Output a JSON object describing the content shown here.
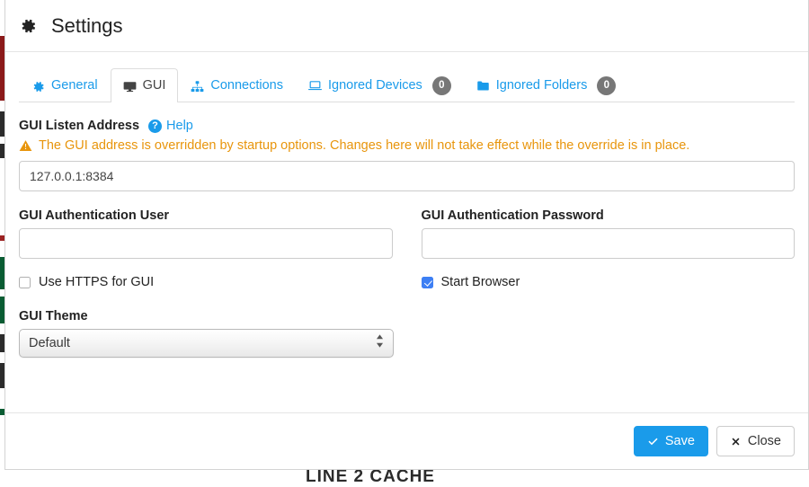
{
  "window": {
    "title": "Settings",
    "title_icon": "gear-icon"
  },
  "colors": {
    "link_blue": "#1a9bea",
    "warning_orange": "#e8950c",
    "badge_gray": "#777777",
    "checkbox_blue": "#3d7ff4",
    "primary_button": "#1a9bea"
  },
  "tabs": [
    {
      "label": "General",
      "icon": "gear-icon",
      "active": false,
      "badge": null
    },
    {
      "label": "GUI",
      "icon": "monitor-icon",
      "active": true,
      "badge": null
    },
    {
      "label": "Connections",
      "icon": "sitemap-icon",
      "active": false,
      "badge": null
    },
    {
      "label": "Ignored Devices",
      "icon": "laptop-icon",
      "active": false,
      "badge": "0"
    },
    {
      "label": "Ignored Folders",
      "icon": "folder-icon",
      "active": false,
      "badge": "0"
    }
  ],
  "form": {
    "listen_address": {
      "label": "GUI Listen Address",
      "help_label": "Help",
      "help_icon": "question-circle-icon",
      "warning_icon": "warning-triangle-icon",
      "warning_text": "The GUI address is overridden by startup options. Changes here will not take effect while the override is in place.",
      "value": "127.0.0.1:8384",
      "placeholder": ""
    },
    "auth_user": {
      "label": "GUI Authentication User",
      "value": "",
      "placeholder": ""
    },
    "auth_password": {
      "label": "GUI Authentication Password",
      "value": "",
      "placeholder": ""
    },
    "use_https": {
      "label": "Use HTTPS for GUI",
      "checked": false
    },
    "start_browser": {
      "label": "Start Browser",
      "checked": true
    },
    "gui_theme": {
      "label": "GUI Theme",
      "selected": "Default",
      "options": [
        "Default"
      ]
    }
  },
  "footer": {
    "save_label": "Save",
    "save_icon": "check-icon",
    "close_label": "Close",
    "close_icon": "x-icon"
  },
  "background": {
    "partial_text": "LINE 2 CACHE"
  }
}
